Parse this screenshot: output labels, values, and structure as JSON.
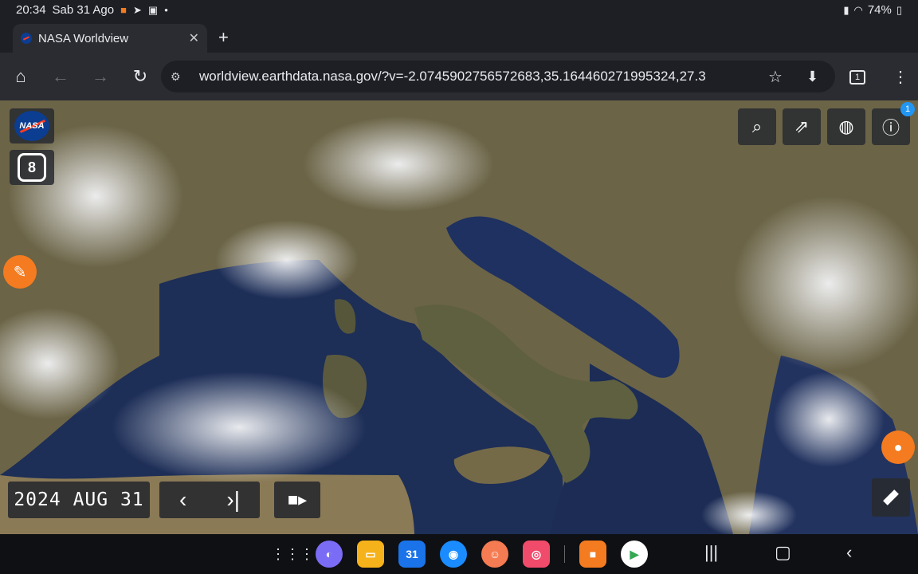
{
  "status_bar": {
    "time": "20:34",
    "date": "Sab 31 Ago",
    "battery": "74%",
    "icons": [
      "video-record-icon",
      "telegram-icon",
      "gallery-icon",
      "dot-icon",
      "battery-saver-icon",
      "wifi-icon",
      "battery-icon"
    ]
  },
  "browser": {
    "tab_title": "NASA Worldview",
    "url": "worldview.earthdata.nasa.gov/?v=-2.0745902756572683,35.164460271995324,27.3",
    "tab_count": "1"
  },
  "worldview": {
    "logo_text": "NASA",
    "layers_count": "8",
    "date": "2024 AUG 31",
    "info_badge": "1",
    "tools": [
      "search-icon",
      "share-icon",
      "projection-icon",
      "info-icon"
    ]
  },
  "dock": {
    "apps": [
      {
        "name": "internet",
        "color": "#7b6cf6"
      },
      {
        "name": "my-files",
        "color": "#f6b21a"
      },
      {
        "name": "calendar",
        "color": "#1a73e8",
        "label": "31"
      },
      {
        "name": "messages",
        "color": "#1a8cff"
      },
      {
        "name": "contacts",
        "color": "#f47b52"
      },
      {
        "name": "camera",
        "color": "#f04b6b"
      },
      {
        "name": "screen-recorder",
        "color": "#f47b20"
      },
      {
        "name": "play-store",
        "color": "#ffffff"
      }
    ]
  },
  "colors": {
    "nasa_blue": "#0b3d91",
    "nasa_red": "#fc3d21",
    "accent_orange": "#f47b20",
    "info_blue": "#2196f3"
  }
}
